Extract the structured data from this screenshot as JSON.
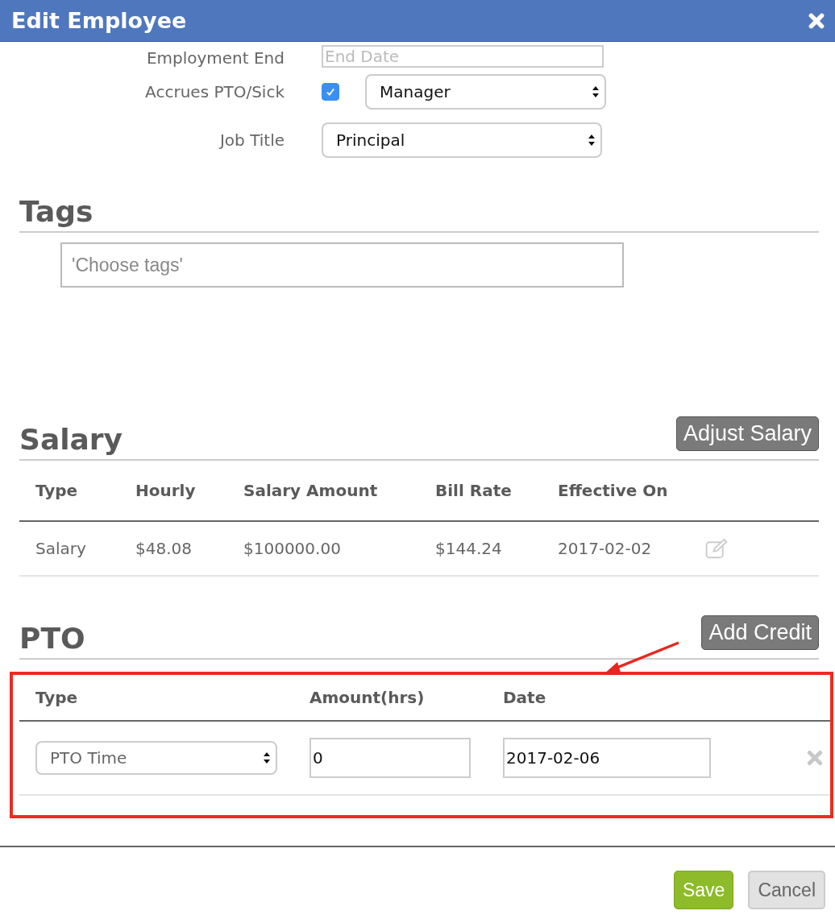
{
  "dialog": {
    "title": "Edit Employee"
  },
  "form_rows": [
    {
      "kind": "date",
      "label": "Employment End",
      "placeholder": "End Date"
    },
    {
      "kind": "checkbox-select",
      "label": "Accrues PTO/Sick",
      "checked": true,
      "value": "Manager"
    },
    {
      "kind": "select",
      "label": "Job Title",
      "value": "Principal"
    }
  ],
  "tags": {
    "heading": "Tags",
    "placeholder": "'Choose tags'"
  },
  "salary": {
    "heading": "Salary",
    "button": "Adjust Salary",
    "columns": [
      "Type",
      "Hourly",
      "Salary Amount",
      "Bill Rate",
      "Effective On"
    ],
    "rows": [
      [
        "Salary",
        "$48.08",
        "$100000.00",
        "$144.24",
        "2017-02-02"
      ]
    ]
  },
  "pto": {
    "heading": "PTO",
    "button": "Add Credit",
    "columns": [
      "Type",
      "Amount(hrs)",
      "Date"
    ],
    "rows": [
      {
        "type": "PTO Time",
        "amount": "0",
        "date": "2017-02-06"
      }
    ]
  },
  "footer": {
    "buttons": [
      {
        "label": "Save",
        "kind": "primary"
      },
      {
        "label": "Cancel",
        "kind": "secondary"
      }
    ]
  }
}
